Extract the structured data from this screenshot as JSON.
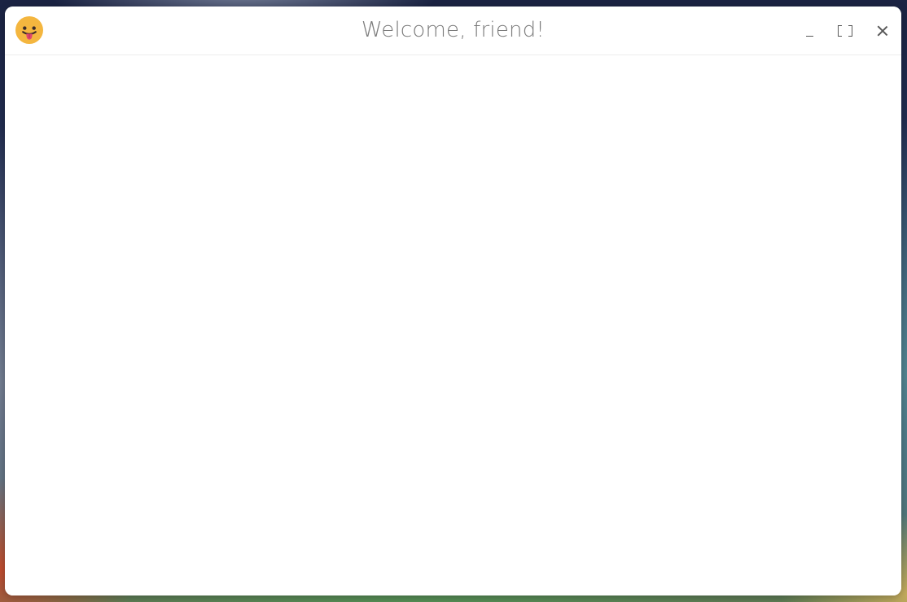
{
  "window": {
    "title": "Welcome, friend!",
    "app_icon": "face-with-tongue-icon",
    "controls": {
      "minimize_icon": "minimize-icon",
      "maximize_icon": "maximize-icon",
      "close_icon": "close-icon"
    }
  },
  "colors": {
    "window_background": "#ffffff",
    "title_text": "#7b7b7b",
    "icon_face": "#f4b63f",
    "icon_tongue": "#e2466f"
  }
}
